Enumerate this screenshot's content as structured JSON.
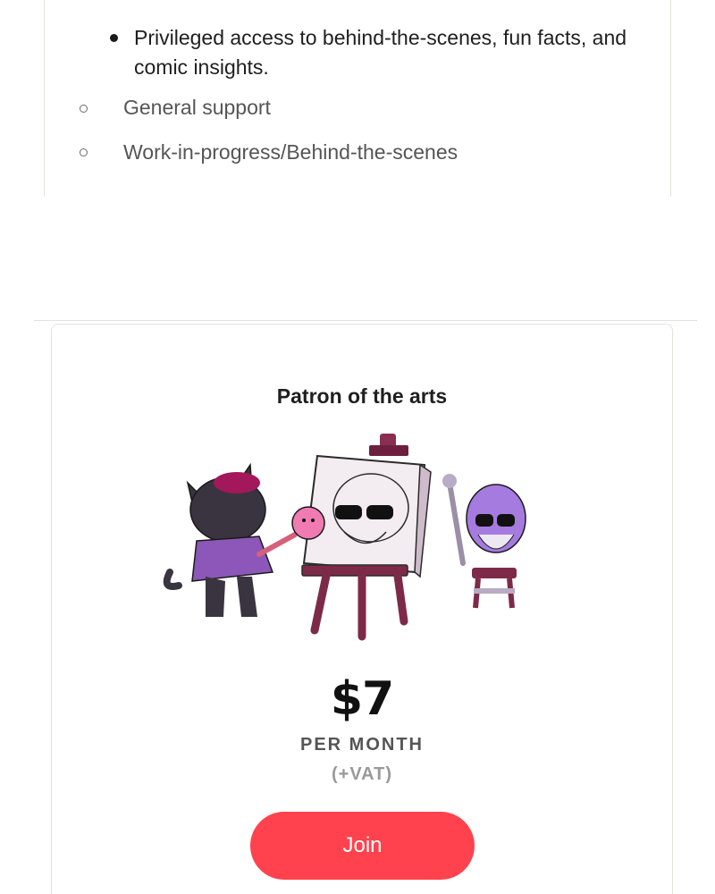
{
  "previous_tier": {
    "benefit_main": "Privileged access to behind-the-scenes, fun facts, and comic insights.",
    "sub_benefits": [
      "General support",
      "Work-in-progress/Behind-the-scenes"
    ]
  },
  "tier": {
    "title": "Patron of the arts",
    "price": "$7",
    "period": "PER MONTH",
    "tax_note": "(+VAT)",
    "join_label": "Join",
    "illustration": "cat-painter-easel-wizard-illustration"
  },
  "colors": {
    "join_button": "#ff424d",
    "border": "#e4e2dc",
    "text_primary": "#1f1f1f",
    "text_secondary": "#555555",
    "text_muted": "#999999"
  }
}
